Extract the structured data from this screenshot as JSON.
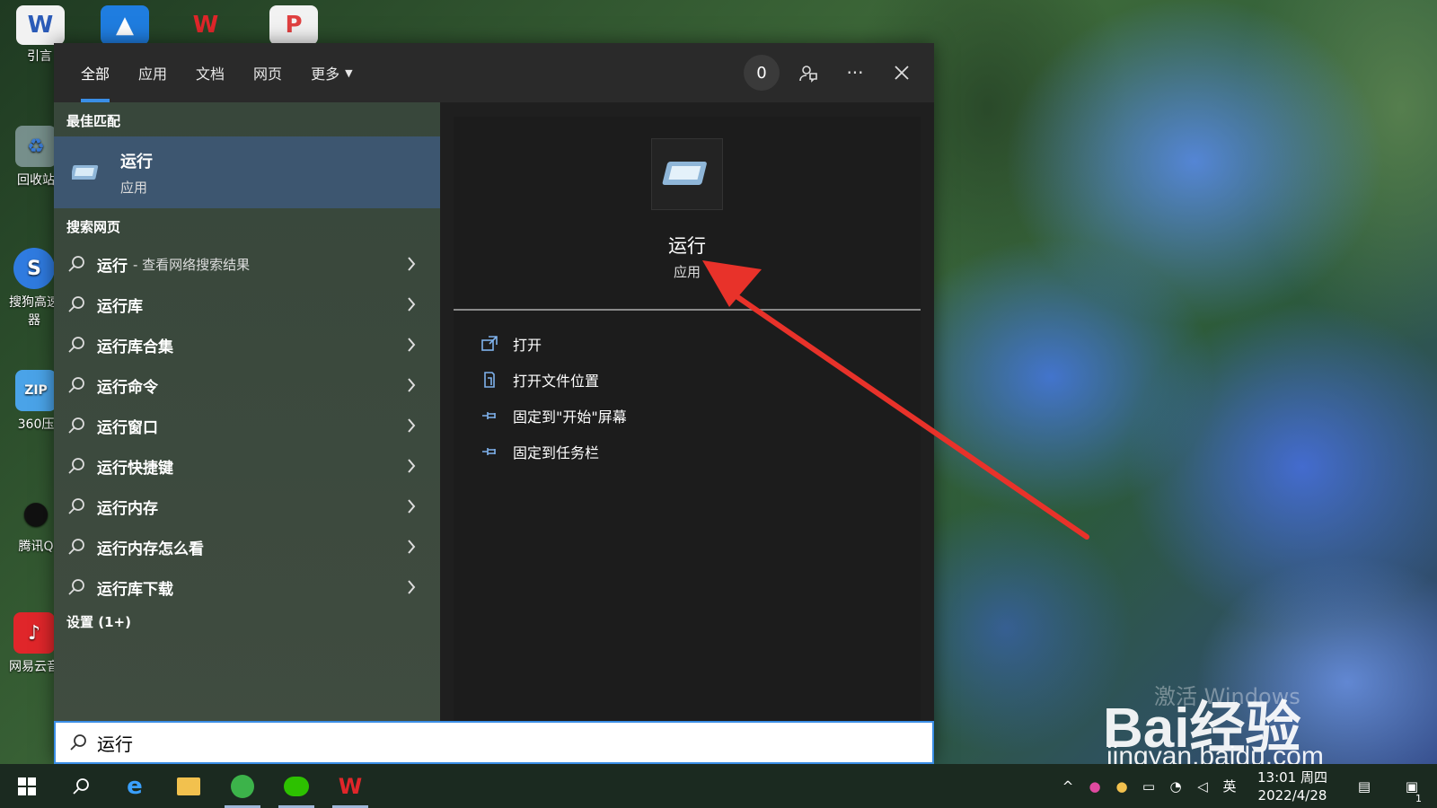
{
  "desktop": {
    "icons": [
      {
        "label": "引言"
      },
      {
        "label": "回收站"
      },
      {
        "label": "搜狗高速"
      },
      {
        "label": "器"
      },
      {
        "label": "360压"
      },
      {
        "label": "腾讯Q"
      },
      {
        "label": "网易云音"
      }
    ]
  },
  "search": {
    "tabs": [
      "全部",
      "应用",
      "文档",
      "网页",
      "更多"
    ],
    "points": "0",
    "best_match_header": "最佳匹配",
    "best_match": {
      "title": "运行",
      "subtitle": "应用"
    },
    "web_header": "搜索网页",
    "web_items": [
      {
        "label": "运行",
        "suffix": "- 查看网络搜索结果"
      },
      {
        "label": "运行库"
      },
      {
        "label": "运行库合集"
      },
      {
        "label": "运行命令"
      },
      {
        "label": "运行窗口"
      },
      {
        "label": "运行快捷键"
      },
      {
        "label": "运行内存"
      },
      {
        "label": "运行内存怎么看"
      },
      {
        "label": "运行库下载"
      }
    ],
    "settings_header": "设置 (1+)",
    "preview": {
      "title": "运行",
      "subtitle": "应用"
    },
    "actions": [
      "打开",
      "打开文件位置",
      "固定到\"开始\"屏幕",
      "固定到任务栏"
    ],
    "query": "运行"
  },
  "watermark": {
    "logo": "Bai经验",
    "url": "jingyan.baidu.com",
    "activate": "激活 Windows"
  },
  "taskbar": {
    "tray_input": "英",
    "clock_time": "13:01 周四",
    "clock_date": "2022/4/28",
    "notification_count": "1"
  },
  "colors": {
    "accent": "#3a8ee6",
    "selected": "#3d5670",
    "arrow": "#e8322a"
  }
}
